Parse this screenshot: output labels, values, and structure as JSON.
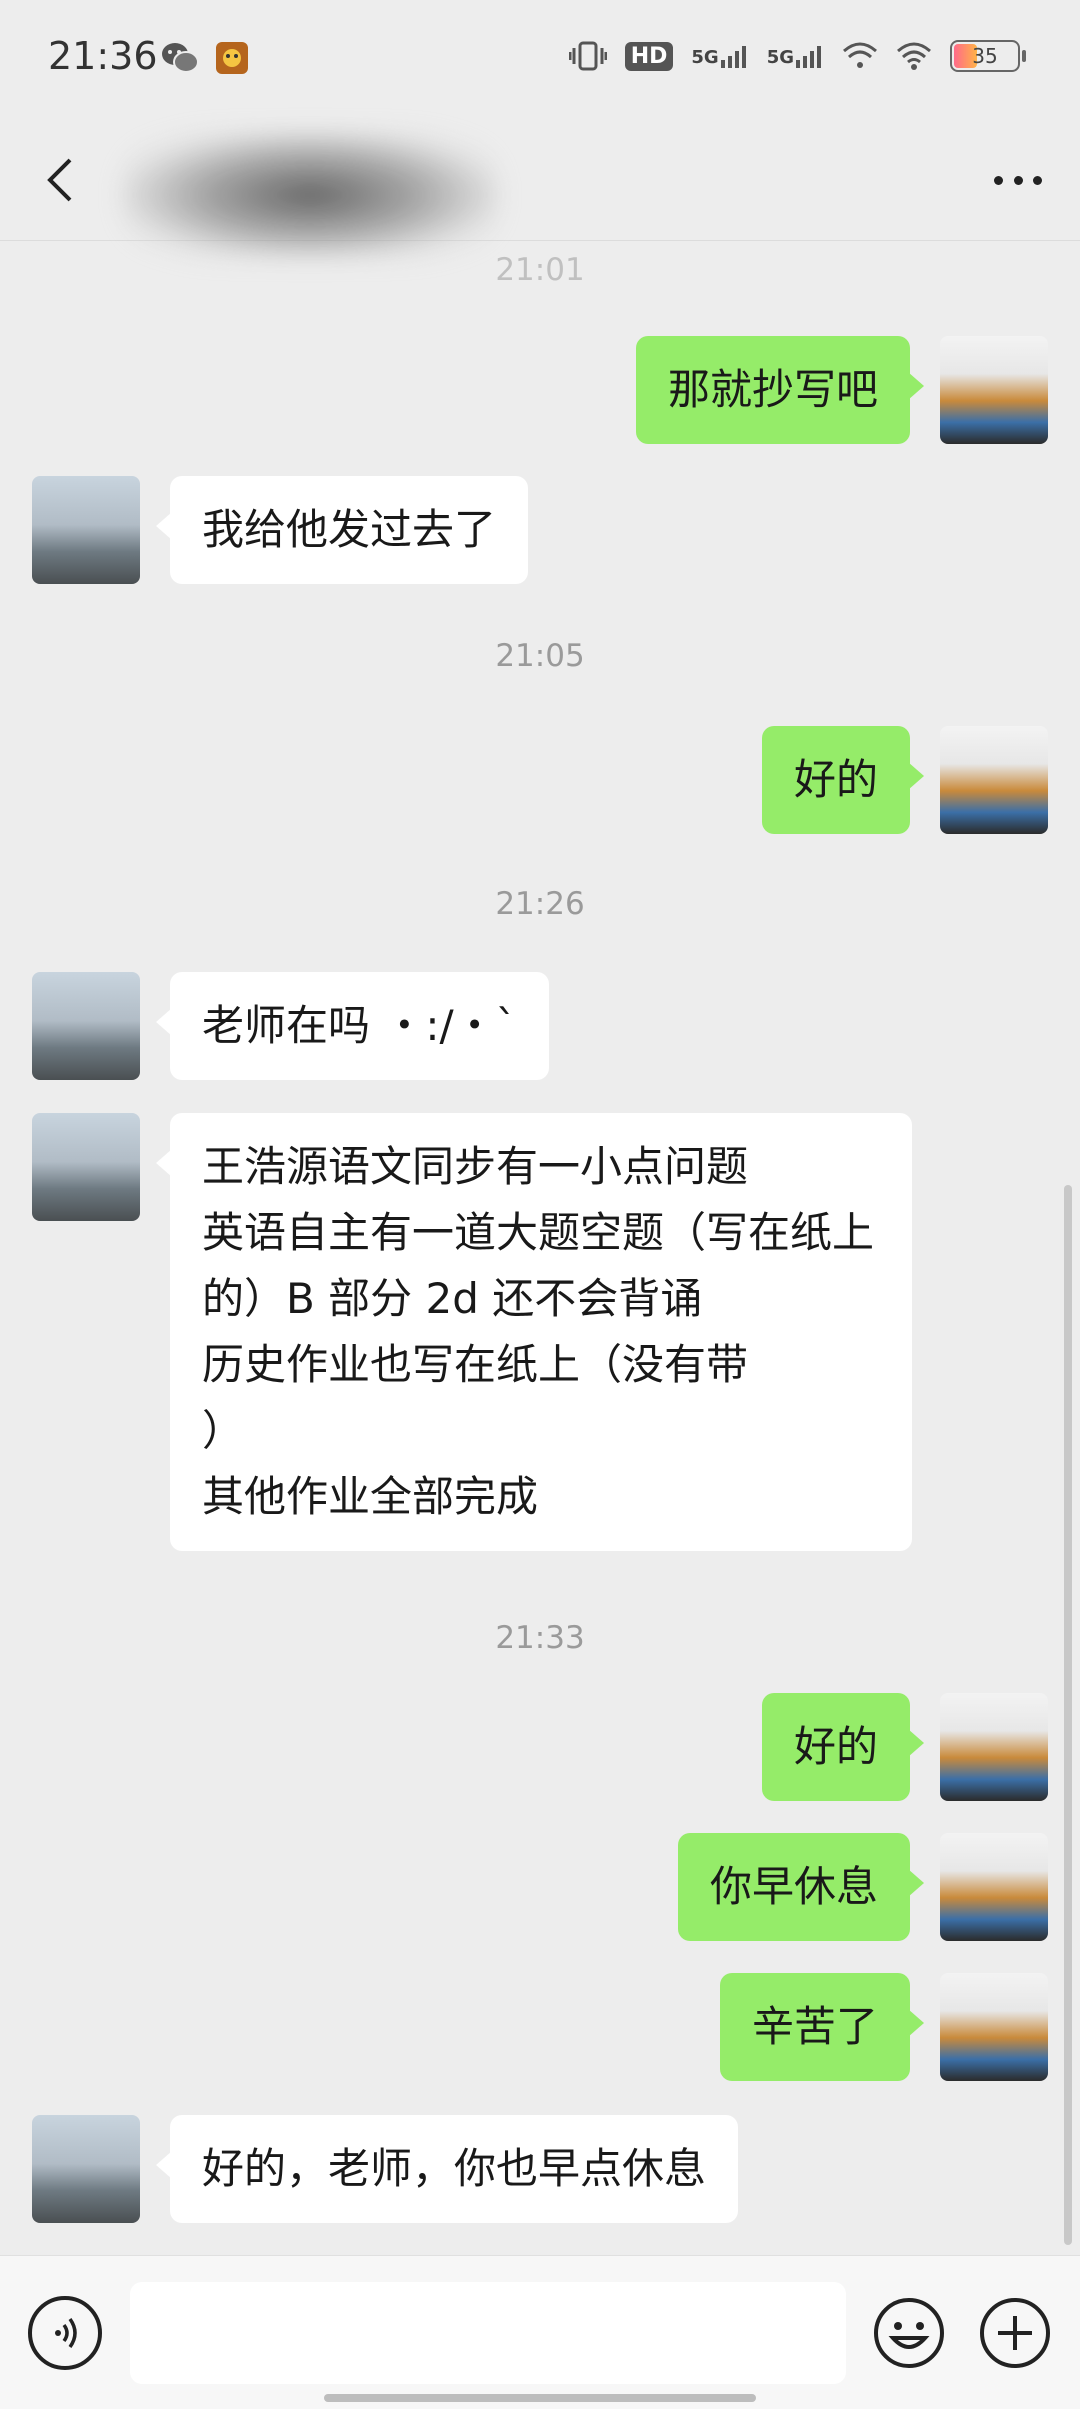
{
  "status_bar": {
    "time": "21:36",
    "network_1": "5G",
    "network_2": "5G",
    "hd_label": "HD",
    "battery": "35"
  },
  "header": {
    "title": ""
  },
  "messages": [
    {
      "type": "timestamp",
      "text": "21:01"
    },
    {
      "type": "outgoing",
      "text": "那就抄写吧"
    },
    {
      "type": "incoming",
      "text": "我给他发过去了"
    },
    {
      "type": "timestamp",
      "text": "21:05"
    },
    {
      "type": "outgoing",
      "text": "好的"
    },
    {
      "type": "timestamp",
      "text": "21:26"
    },
    {
      "type": "incoming",
      "text": "老师在吗 ・:/・ˋ"
    },
    {
      "type": "incoming",
      "text": "王浩源语文同步有一小点问题\n英语自主有一道大题空题（写在纸上的）B 部分 2d 还不会背诵\n历史作业也写在纸上（没有带\n）\n其他作业全部完成"
    },
    {
      "type": "timestamp",
      "text": "21:33"
    },
    {
      "type": "outgoing",
      "text": "好的"
    },
    {
      "type": "outgoing",
      "text": "你早休息"
    },
    {
      "type": "outgoing",
      "text": "辛苦了"
    },
    {
      "type": "incoming",
      "text": "好的，老师，你也早点休息"
    }
  ],
  "input": {
    "placeholder": ""
  },
  "icons": {
    "back": "chevron-left-icon",
    "more": "more-dots-icon",
    "voice": "voice-icon",
    "emoji": "emoji-icon",
    "plus": "plus-icon"
  },
  "colors": {
    "outgoing_bubble": "#95ec69",
    "incoming_bubble": "#ffffff",
    "background": "#ededed"
  }
}
